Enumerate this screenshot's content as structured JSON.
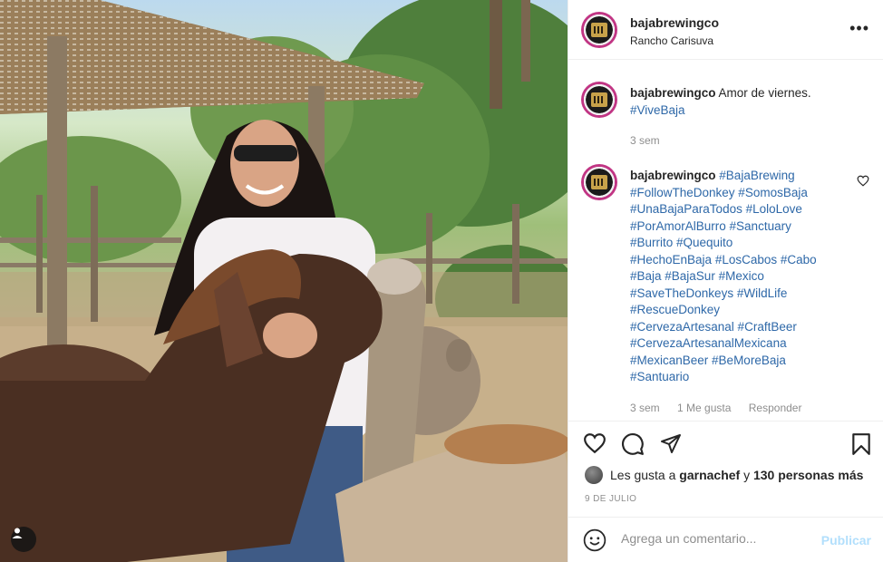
{
  "post": {
    "username": "bajabrewingco",
    "location": "Rancho Carisuva",
    "more_icon": "more-horizontal-icon"
  },
  "caption": {
    "username": "bajabrewingco",
    "text": "Amor de viernes.",
    "hashtag": "#ViveBaja",
    "time": "3 sem"
  },
  "comment": {
    "username": "bajabrewingco",
    "lines": [
      "#BajaBrewing",
      "#FollowTheDonkey #SomosBaja",
      "#UnaBajaParaTodos #LoloLove",
      "#PorAmorAlBurro #Sanctuary",
      "#Burrito #Quequito",
      "#HechoEnBaja #LosCabos #Cabo",
      "#Baja #BajaSur #Mexico",
      "#SaveTheDonkeys #WildLife",
      "#RescueDonkey",
      "#CervezaArtesanal #CraftBeer",
      "#CervezaArtesanalMexicana",
      "#MexicanBeer #BeMoreBaja",
      "#Santuario"
    ],
    "time": "3 sem",
    "likes": "1 Me gusta",
    "reply": "Responder"
  },
  "likes": {
    "prefix": "Les gusta a",
    "user": "garnachef",
    "middle": "y",
    "count": "130 personas más"
  },
  "date": "9 DE JULIO",
  "add_comment": {
    "placeholder": "Agrega un comentario...",
    "publish": "Publicar"
  },
  "colors": {
    "hashtag": "#2e68a8",
    "publish_disabled": "#b2dffc",
    "meta": "#8e8e8e"
  }
}
